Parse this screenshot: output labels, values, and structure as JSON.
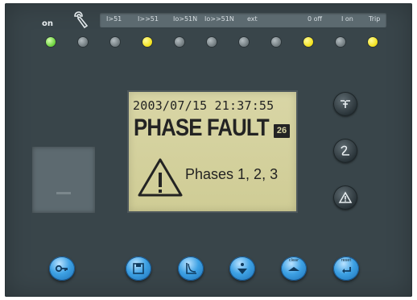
{
  "status_bar": {
    "on_label": "on",
    "indicators": [
      "I>51",
      "I>>51",
      "Io>51N",
      "Io>>51N",
      "ext",
      "0 off",
      "I on",
      "Trip"
    ]
  },
  "leds": {
    "states": [
      "green",
      "grey",
      "grey",
      "yellow",
      "grey",
      "grey",
      "grey",
      "grey",
      "yellow",
      "grey",
      "yellow"
    ],
    "colors": {
      "green": "#6ed33f",
      "yellow": "#f3e21f",
      "grey": "#8a9498"
    }
  },
  "display": {
    "datetime": "2003/07/15 21:37:55",
    "fault": "PHASE FAULT",
    "badge": "26",
    "message": "Phases 1, 2, 3"
  },
  "side_buttons": [
    "breaker-icon",
    "resistance-icon",
    "warning-icon"
  ],
  "bottom_buttons": {
    "icons": [
      "key-icon",
      "save-icon",
      "curve-icon",
      "enter-down-icon",
      "clear-icon",
      "reset-icon"
    ],
    "labels": {
      "clear": "clear",
      "reset": "reset"
    }
  },
  "colors": {
    "panel": "#39454a",
    "button_blue": "#3da1e4",
    "lcd_bg": "#d3d09b"
  }
}
